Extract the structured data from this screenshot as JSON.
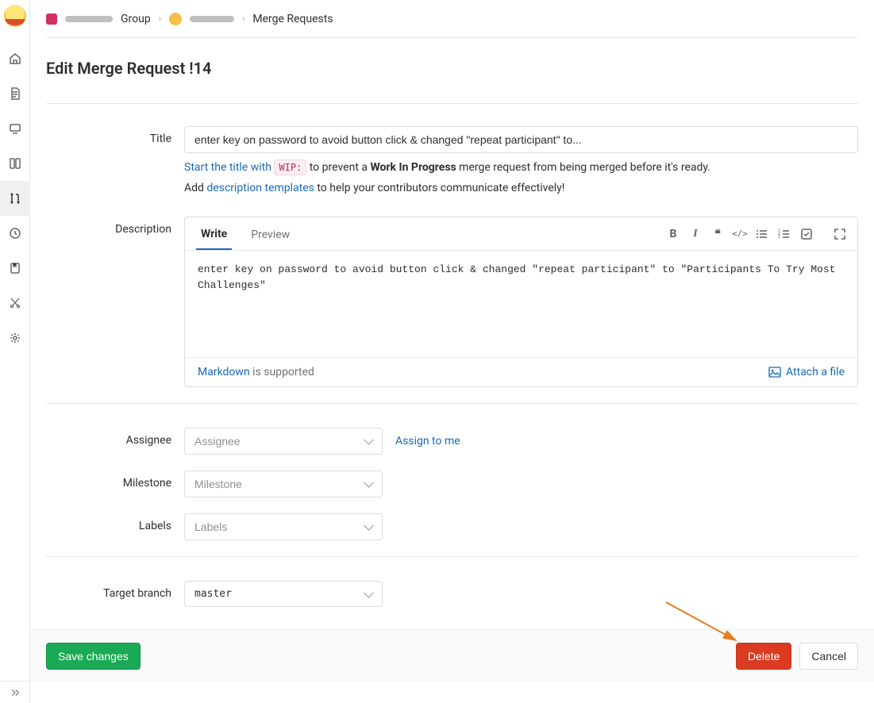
{
  "breadcrumbs": {
    "group_suffix": "Group",
    "final": "Merge Requests"
  },
  "page_title": "Edit Merge Request !14",
  "title_field": {
    "label": "Title",
    "value": "enter key on password to avoid button click & changed \"repeat participant\" to..."
  },
  "wip_hint": {
    "prefix": "Start the title with ",
    "code": "WIP:",
    "mid": " to prevent a ",
    "strong": "Work In Progress",
    "suffix": " merge request from being merged before it's ready."
  },
  "template_hint": {
    "prefix": "Add ",
    "link": "description templates",
    "suffix": " to help your contributors communicate effectively!"
  },
  "description": {
    "label": "Description",
    "tabs": {
      "write": "Write",
      "preview": "Preview"
    },
    "body": "enter key on password to avoid button click & changed \"repeat participant\" to \"Participants To Try Most Challenges\"",
    "footer_md_link": "Markdown",
    "footer_md_text": " is supported",
    "attach": "Attach a file"
  },
  "assignee": {
    "label": "Assignee",
    "placeholder": "Assignee",
    "assign_to_me": "Assign to me"
  },
  "milestone": {
    "label": "Milestone",
    "placeholder": "Milestone"
  },
  "labels": {
    "label": "Labels",
    "placeholder": "Labels"
  },
  "target_branch": {
    "label": "Target branch",
    "value": "master"
  },
  "actions": {
    "save": "Save changes",
    "delete": "Delete",
    "cancel": "Cancel"
  }
}
